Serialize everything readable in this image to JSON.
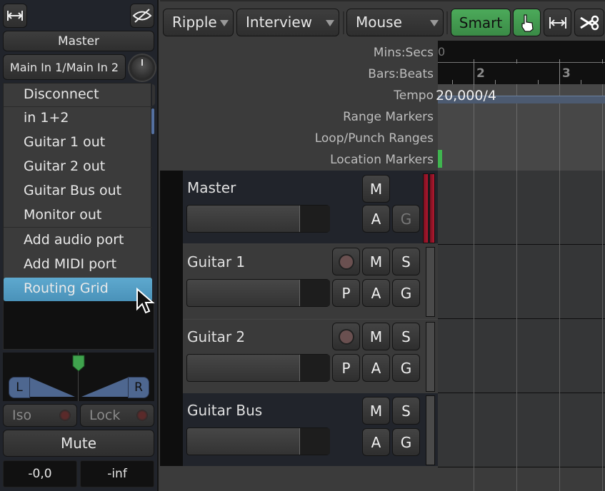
{
  "strip": {
    "name": "Master",
    "input": "Main In 1/Main In 2",
    "icons": {
      "width": "width-arrows-icon",
      "hide": "eye-hidden-icon"
    },
    "menu": {
      "items": [
        {
          "label": "Disconnect"
        },
        {
          "label": "in 1+2"
        },
        {
          "label": "Guitar 1 out"
        },
        {
          "label": "Guitar 2 out"
        },
        {
          "label": "Guitar Bus out"
        },
        {
          "label": "Monitor out"
        },
        {
          "label": "Add audio port"
        },
        {
          "label": "Add MIDI port"
        },
        {
          "label": "Routing Grid"
        }
      ],
      "highlighted": "Routing Grid"
    },
    "panner": {
      "left_label": "L",
      "right_label": "R",
      "position": "center"
    },
    "iso_label": "Iso",
    "lock_label": "Lock",
    "mute_label": "Mute",
    "gain_readout": "-0,0",
    "peak_readout": "-inf"
  },
  "toolbar": {
    "edit_mode": "Ripple",
    "ripple_mode": "Interview",
    "mouse_mode": "Mouse",
    "smart_label": "Smart",
    "tools": [
      "grab-hand-icon",
      "stretch-icon",
      "cut-scissors-icon"
    ]
  },
  "rulers": {
    "labels": [
      "Mins:Secs",
      "Bars:Beats",
      "Tempo",
      "Range Markers",
      "Loop/Punch Ranges",
      "Location Markers"
    ],
    "mins_value": "0",
    "bar_numbers": [
      "2",
      "3"
    ],
    "tempo_value": "20,000/4"
  },
  "tracks": [
    {
      "name": "Master",
      "buttons": [
        "M",
        "A",
        "G"
      ],
      "type": "bus"
    },
    {
      "name": "Guitar 1",
      "buttons": [
        "M",
        "S",
        "P",
        "A",
        "G"
      ],
      "type": "audio"
    },
    {
      "name": "Guitar 2",
      "buttons": [
        "M",
        "S",
        "P",
        "A",
        "G"
      ],
      "type": "audio"
    },
    {
      "name": "Guitar Bus",
      "buttons": [
        "M",
        "S",
        "A",
        "G"
      ],
      "type": "bus"
    }
  ],
  "colors": {
    "accent_green": "#3fb54f",
    "menu_highlight": "#5ea9cf",
    "panner_blue": "#4e6790"
  }
}
